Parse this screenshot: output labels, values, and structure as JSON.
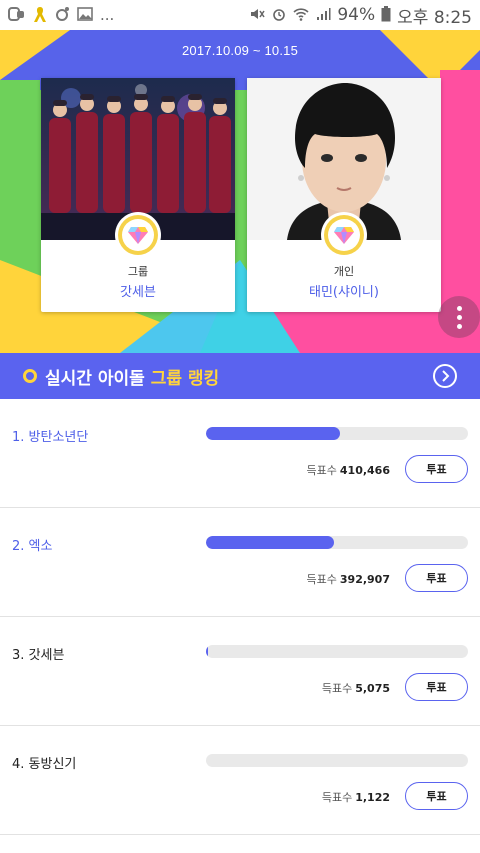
{
  "status_bar": {
    "battery": "94%",
    "time": "오후 8:25",
    "ellipsis": "..."
  },
  "hero": {
    "period": "2017.10.09 ~ 10.15",
    "cards": [
      {
        "category": "그룹",
        "name": "갓세븐"
      },
      {
        "category": "개인",
        "name": "태민(샤이니)"
      }
    ]
  },
  "ranking": {
    "title_plain": "실시간 아이돌 ",
    "title_highlight": "그룹 랭킹",
    "votes_label": "득표수",
    "vote_button": "투표",
    "items": [
      {
        "rank_label": "1. 방탄소년단",
        "votes": "410,466",
        "share": 0.51
      },
      {
        "rank_label": "2. 엑소",
        "votes": "392,907",
        "share": 0.49
      },
      {
        "rank_label": "3. 갓세븐",
        "votes": "5,075",
        "share": 0.006
      },
      {
        "rank_label": "4. 동방신기",
        "votes": "1,122",
        "share": 0.0
      }
    ]
  },
  "colors": {
    "accent": "#5a63ef",
    "highlight": "#ffd43b",
    "rank_top": "#4e5fe8"
  }
}
